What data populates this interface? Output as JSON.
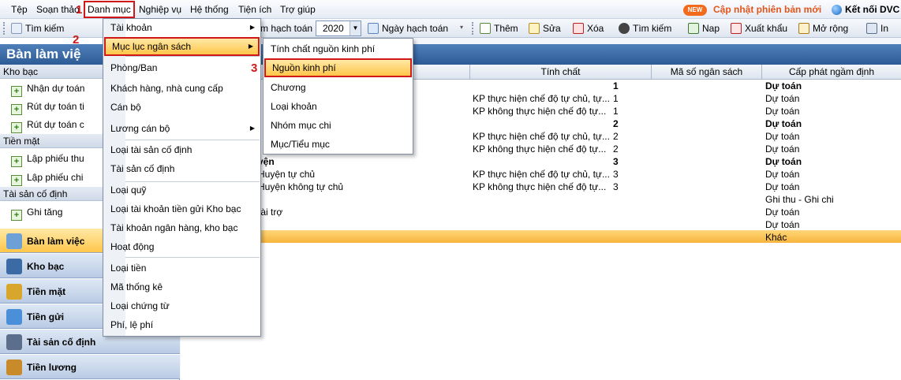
{
  "menubar": {
    "items": [
      "Tệp",
      "Soạn thảo",
      "Danh mục",
      "Nghiệp vụ",
      "Hệ thống",
      "Tiện ích",
      "Trợ giúp"
    ],
    "new_badge": "NEW",
    "update_label": "Cập nhật phiên bản mới",
    "connect_label": "Kết nối DVC"
  },
  "steps": [
    "1",
    "2",
    "3"
  ],
  "toolbar": {
    "search_label": "Tìm kiếm",
    "period_label": "m hạch toán",
    "year_value": "2020",
    "date_label": "Ngày hạch toán",
    "add_label": "Thêm",
    "edit_label": "Sửa",
    "delete_label": "Xóa",
    "find_label": "Tìm kiếm",
    "load_label": "Nap",
    "export_label": "Xuất khẩu",
    "expand_label": "Mở rộng",
    "print_label": "In"
  },
  "sidebar": {
    "title": "Bàn làm việ",
    "groups": [
      {
        "label": "Kho bạc",
        "items": [
          "Nhận dự toán",
          "Rút dự toán ti",
          "Rút dự toán c"
        ]
      },
      {
        "label": "Tiền mặt",
        "items": [
          "Lập phiếu thu",
          "Lập phiếu chi"
        ]
      },
      {
        "label": "Tài sản cố định",
        "items": [
          "Ghi tăng"
        ]
      }
    ],
    "nav": [
      "Bàn làm việc",
      "Kho bạc",
      "Tiền mặt",
      "Tiền gửi",
      "Tài sản cố định",
      "Tiền lương"
    ]
  },
  "colors": {
    "accent": "#2d5b96",
    "highlight": "#d01818",
    "orange": "#f7b53b",
    "new_badge": "#f26b1d"
  },
  "grid": {
    "columns": [
      "Tính chất",
      "Mã số ngân sách",
      "Cấp phát ngầm định"
    ],
    "rows": [
      {
        "name": "",
        "prop": "",
        "code": "1",
        "alloc": "Dự toán",
        "bold": true
      },
      {
        "name": "",
        "prop": "KP thực hiện chế độ tự chủ, tự...",
        "code": "1",
        "alloc": "Dự toán",
        "bold": false
      },
      {
        "name": "",
        "prop": "KP không thực hiện chế độ tự...",
        "code": "1",
        "alloc": "Dự toán",
        "bold": false
      },
      {
        "name": "",
        "prop": "",
        "code": "2",
        "alloc": "Dự toán",
        "bold": true
      },
      {
        "name": "",
        "prop": "KP thực hiện chế độ tự chủ, tự...",
        "code": "2",
        "alloc": "Dự toán",
        "bold": false
      },
      {
        "name": "",
        "prop": "KP không thực hiện chế độ tự...",
        "code": "2",
        "alloc": "Dự toán",
        "bold": false
      },
      {
        "name": "yện",
        "prop": "",
        "code": "3",
        "alloc": "Dự toán",
        "bold": true
      },
      {
        "name": "Huyện tự chủ",
        "prop": "KP thực hiện chế độ tự chủ, tự...",
        "code": "3",
        "alloc": "Dự toán",
        "bold": false
      },
      {
        "name": "Huyện không tự chủ",
        "prop": "KP không thực hiện chế độ tự...",
        "code": "3",
        "alloc": "Dự toán",
        "bold": false
      },
      {
        "name": "",
        "prop": "",
        "code": "",
        "alloc": "Ghi thu - Ghi chi",
        "bold": false
      },
      {
        "name": "tài trợ",
        "prop": "",
        "code": "",
        "alloc": "Dự toán",
        "bold": false
      },
      {
        "name": "",
        "prop": "",
        "code": "",
        "alloc": "Dự toán",
        "bold": false
      },
      {
        "name": "",
        "prop": "",
        "code": "",
        "alloc": "Khác",
        "bold": false
      }
    ]
  },
  "menu_danhmuc": [
    "Tài khoản",
    "Mục lục ngân sách",
    "Phòng/Ban",
    "Khách hàng, nhà cung cấp",
    "Cán bộ",
    "Lương cán bộ",
    "Loại tài sản cố định",
    "Tài sản cố định",
    "Loại quỹ",
    "Loại tài khoản tiền gửi Kho bạc",
    "Tài khoản ngân hàng, kho bạc",
    "Hoạt động",
    "Loại tiền",
    "Mã thống kê",
    "Loại chứng từ",
    "Phí, lệ phí"
  ],
  "submenu_mucluc": [
    "Tính chất nguồn kinh phí",
    "Nguồn kinh phí",
    "Chương",
    "Loại khoản",
    "Nhóm mục chi",
    "Mục/Tiểu mục"
  ]
}
